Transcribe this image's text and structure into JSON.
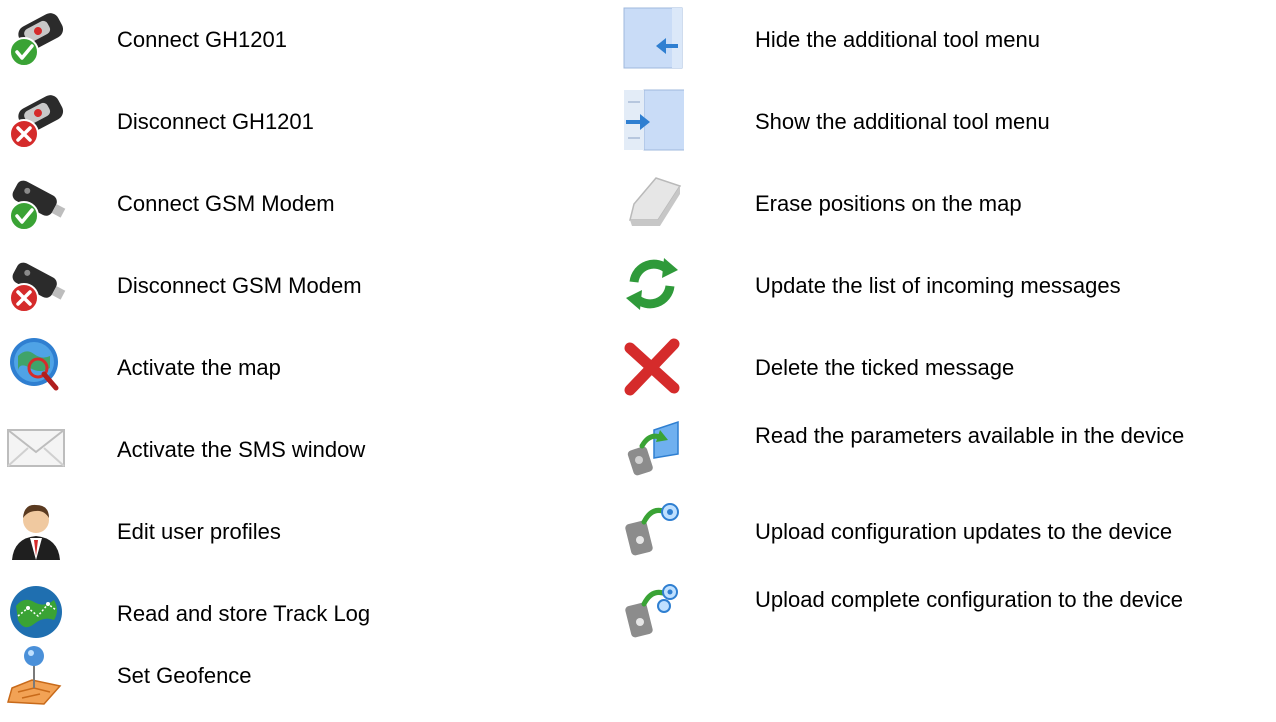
{
  "left_items": [
    {
      "label": "Connect GH1201",
      "icon": "device-connect-icon"
    },
    {
      "label": "Disconnect GH1201",
      "icon": "device-disconnect-icon"
    },
    {
      "label": "Connect GSM Modem",
      "icon": "modem-connect-icon"
    },
    {
      "label": "Disconnect GSM Modem",
      "icon": "modem-disconnect-icon"
    },
    {
      "label": "Activate the map",
      "icon": "map-magnifier-icon"
    },
    {
      "label": "Activate the SMS window",
      "icon": "envelope-icon"
    },
    {
      "label": "Edit user profiles",
      "icon": "user-profile-icon"
    },
    {
      "label": "Read and store Track Log",
      "icon": "globe-track-icon"
    },
    {
      "label": "Set Geofence",
      "icon": "map-pin-icon"
    }
  ],
  "right_items": [
    {
      "label": "Hide the additional tool menu",
      "icon": "hide-panel-icon"
    },
    {
      "label": "Show the additional tool menu",
      "icon": "show-panel-icon"
    },
    {
      "label": "Erase positions on the map",
      "icon": "eraser-icon"
    },
    {
      "label": "Update the list of incoming messages",
      "icon": "refresh-icon"
    },
    {
      "label": "Delete the ticked message",
      "icon": "delete-x-icon"
    },
    {
      "label": "Read the parameters available in the device",
      "icon": "read-params-icon"
    },
    {
      "label": "Upload configuration updates to the device",
      "icon": "upload-updates-icon"
    },
    {
      "label": "Upload complete configuration to the device",
      "icon": "upload-complete-icon"
    }
  ],
  "colors": {
    "check_green": "#3aa335",
    "cross_red": "#d52b2b",
    "device_dark": "#2b2b2b",
    "panel_blue": "#c9dcf7",
    "arrow_blue": "#2f7fd1"
  }
}
